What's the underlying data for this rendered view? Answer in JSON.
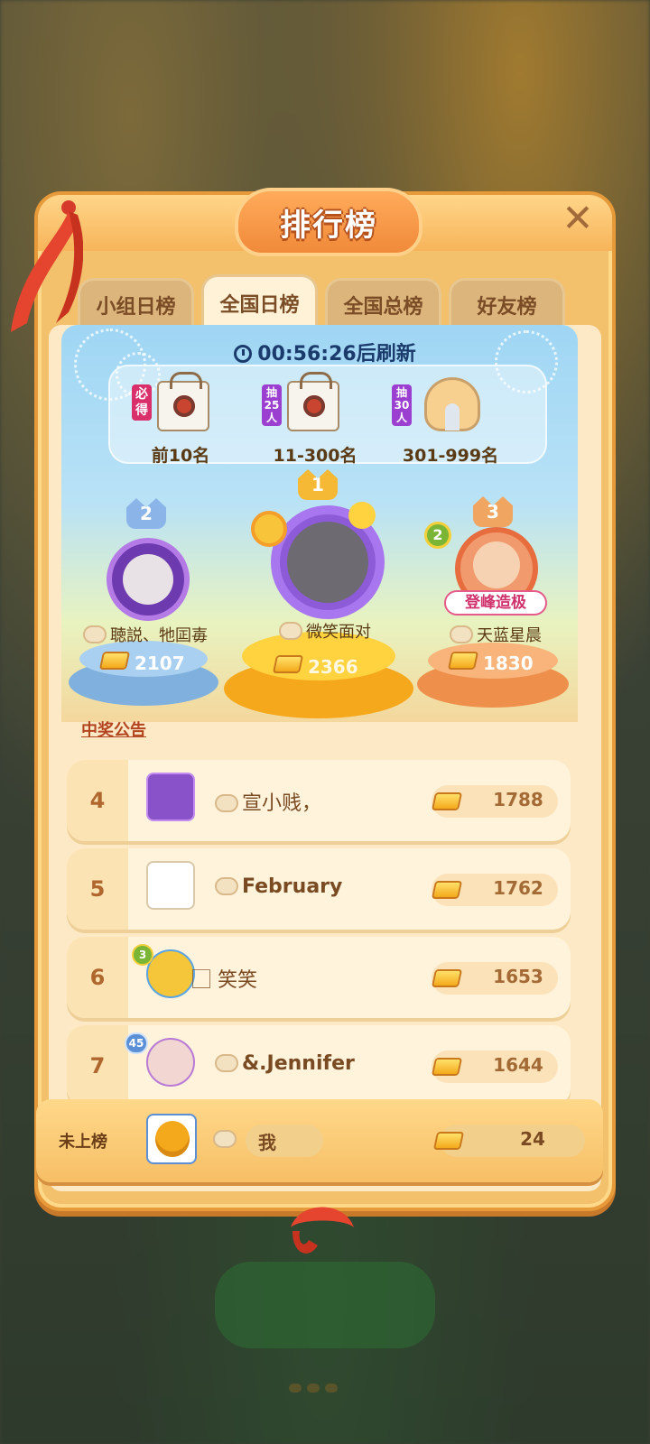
{
  "header": {
    "title": "排行榜",
    "close_label": "✕"
  },
  "tabs": [
    {
      "label": "小组日榜",
      "active": false
    },
    {
      "label": "全国日榜",
      "active": true
    },
    {
      "label": "全国总榜",
      "active": false
    },
    {
      "label": "好友榜",
      "active": false
    }
  ],
  "timer": {
    "text": "00:56:26后刷新"
  },
  "rewards": [
    {
      "tag": "必得",
      "label": "前10名",
      "icon": "gift-bag-icon"
    },
    {
      "tag": "抽25人",
      "label": "11-300名",
      "icon": "gift-bag-icon"
    },
    {
      "tag": "抽30人",
      "label": "301-999名",
      "icon": "neck-pillow-icon"
    }
  ],
  "podium": {
    "first": {
      "rank": "1",
      "name": "微笑面对",
      "score": "2366"
    },
    "second": {
      "rank": "2",
      "name": "聴説、牠囸毐",
      "score": "2107"
    },
    "third": {
      "rank": "3",
      "name": "天蓝星晨",
      "score": "1830",
      "badge": "登峰造极",
      "level": "2"
    }
  },
  "announcement": "中奖公告",
  "rows": [
    {
      "rank": "4",
      "name": "宣小贱，",
      "score": "1788"
    },
    {
      "rank": "5",
      "name": "February",
      "score": "1762"
    },
    {
      "rank": "6",
      "name": "⃞ 笑笑",
      "score": "1653",
      "level": "3"
    },
    {
      "rank": "7",
      "name": "&.Jennifer",
      "score": "1644",
      "level": "45"
    }
  ],
  "me": {
    "rank_label": "未上榜",
    "name": "我",
    "score": "24"
  },
  "colors": {
    "panel": "#f3c06b",
    "accent": "#f08a3a",
    "gold": "#f3a91b",
    "text": "#7a4b22"
  }
}
